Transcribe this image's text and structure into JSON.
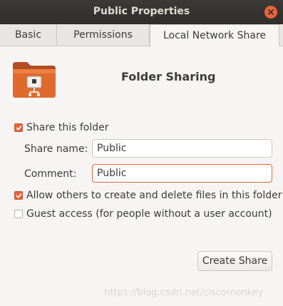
{
  "window": {
    "title": "Public Properties"
  },
  "tabs": [
    {
      "label": "Basic",
      "active": false
    },
    {
      "label": "Permissions",
      "active": false
    },
    {
      "label": "Local Network Share",
      "active": true
    }
  ],
  "sharing": {
    "heading": "Folder Sharing",
    "folder_icon": "folder-share-icon",
    "share_this_folder": {
      "label": "Share this folder",
      "checked": true
    },
    "share_name": {
      "label": "Share name:",
      "value": "Public"
    },
    "comment": {
      "label": "Comment:",
      "value": "Public"
    },
    "allow_others": {
      "label": "Allow others to create and delete files in this folder",
      "checked": true
    },
    "guest_access": {
      "label": "Guest access (for people without a user account)",
      "checked": false
    },
    "create_button": "Create Share"
  },
  "watermark": "https://blog.csdn.net/ciscomonkey",
  "colors": {
    "accent": "#e9643a",
    "titlebar": "#3b3a37",
    "background": "#f6f5f4"
  }
}
